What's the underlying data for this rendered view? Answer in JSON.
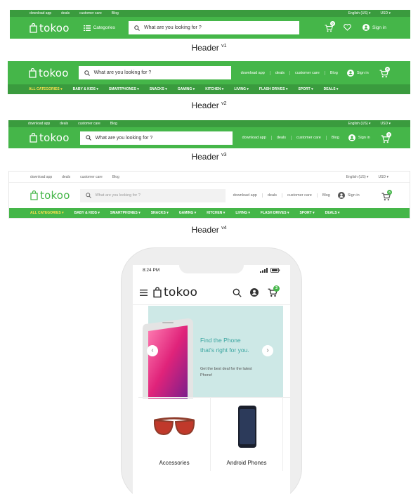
{
  "colors": {
    "brand_green": "#45b649",
    "dark_green": "#3a9b3e",
    "highlight": "#ffe14d"
  },
  "topbar": {
    "download": "download app",
    "deals": "deals",
    "care": "customer care",
    "blog": "Blog",
    "lang": "English (US) ▾",
    "currency": "USD ▾"
  },
  "brand": "tokoo",
  "search_placeholder": "What are you looking for ?",
  "nav": {
    "categories": "Categories",
    "download": "download app",
    "deals": "deals",
    "care": "customer care",
    "blog": "Blog",
    "signin": "Sign in",
    "cart_count": "0"
  },
  "categories": [
    "ALL CATEGORIES ▾",
    "BABY & KIDS ▾",
    "SMARTPHONES ▾",
    "SNACKS ▾",
    "GAMING ▾",
    "KITCHEN ▾",
    "LIVING ▾",
    "FLASH DRIVES ▾",
    "SPORT ▾",
    "DEALS ▾"
  ],
  "captions": [
    {
      "text": "Header",
      "ver": "v1"
    },
    {
      "text": "Header",
      "ver": "v2"
    },
    {
      "text": "Header",
      "ver": "v3"
    },
    {
      "text": "Header",
      "ver": "v4"
    }
  ],
  "mobile": {
    "time": "8:24 PM",
    "cart_count": "3",
    "banner_title_1": "Find the Phone",
    "banner_title_2": "that's right for you.",
    "banner_sub_1": "Get the best deal for the latest",
    "banner_sub_2": "Phone!",
    "tiles": [
      "Accessories",
      "Android Phones"
    ]
  }
}
